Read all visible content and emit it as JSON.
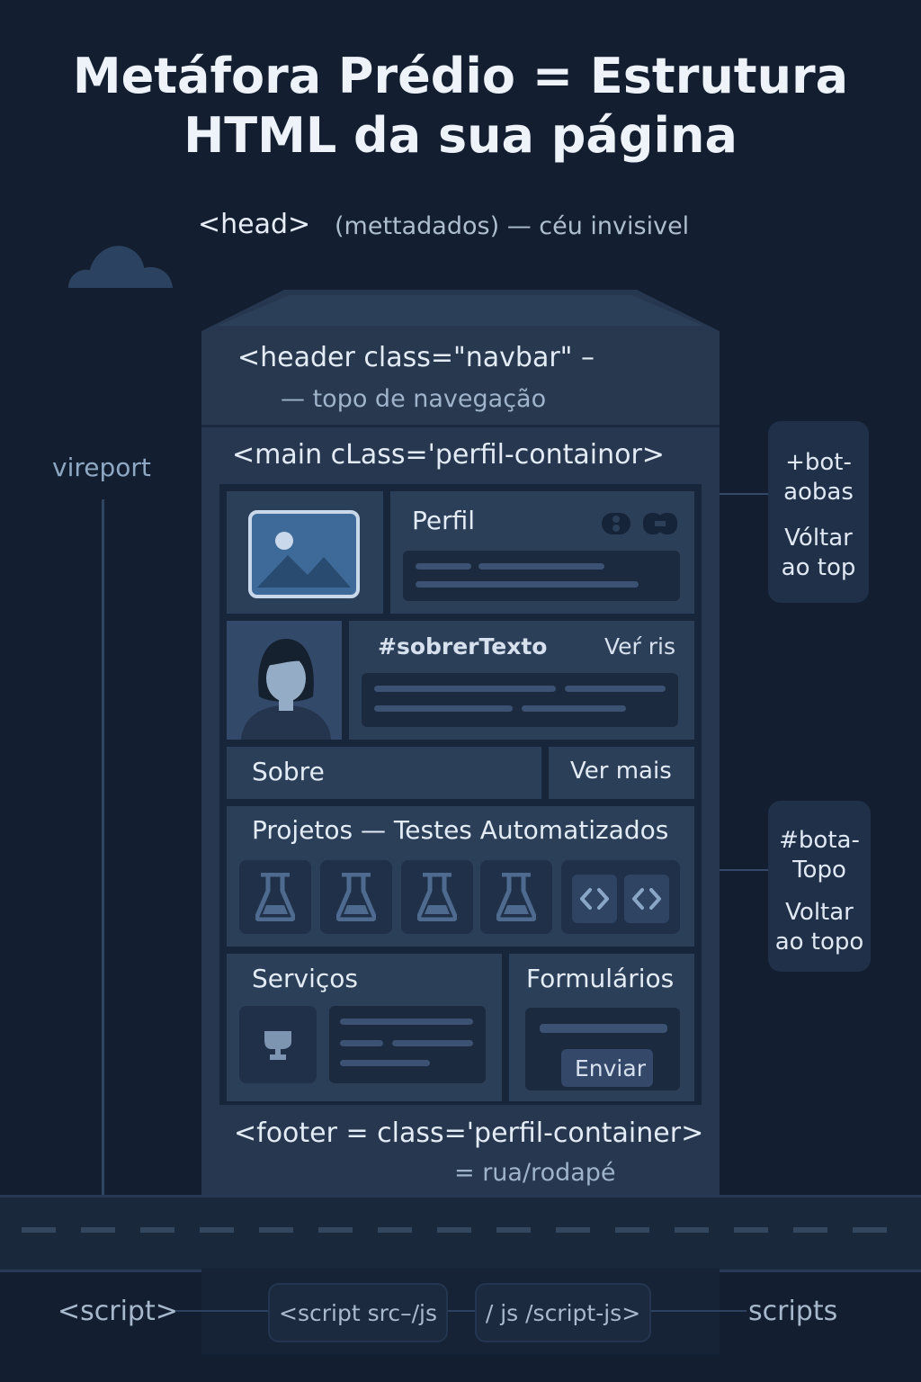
{
  "title": {
    "line1": "Metáfora Prédio = Estrutura",
    "line2": "HTML da sua página"
  },
  "head": {
    "tag": "<head>",
    "note": "(mettadados) — céu invisivel"
  },
  "viewport_label": "vireport",
  "building": {
    "header_tag": "<header class=\"navbar\" –",
    "header_note": "— topo de navegação",
    "main_tag": "<main cLass='perfil-containor>",
    "perfil": "Perfil",
    "sobre_texto": "#sobrerTexto",
    "ver_ris": "Veŕ ris",
    "sobre": "Sobre",
    "ver_mais": "Ver mais",
    "projetos": "Projetos — Testes Automatizados",
    "servicos": "Serviços",
    "formularios": "Formulários",
    "enviar": "Enviar",
    "footer_tag": "<footer = class='perfil-container>",
    "footer_note": "= rua/rodapé"
  },
  "side_boxes": [
    {
      "line1": "+bot-",
      "line2": "aobas",
      "line3": "Vóltar",
      "line4": "ao top"
    },
    {
      "line1": "#bota-",
      "line2": "Topo",
      "line3": "Voltar",
      "line4": "ao topo"
    }
  ],
  "scripts": {
    "left": "<script>",
    "box1": "<script src–/js",
    "box2": "/ js /script-js>",
    "right": "scripts"
  },
  "colors": {
    "background": "#131f30",
    "building": "#26374f",
    "accent_image": "#3e6a99"
  }
}
